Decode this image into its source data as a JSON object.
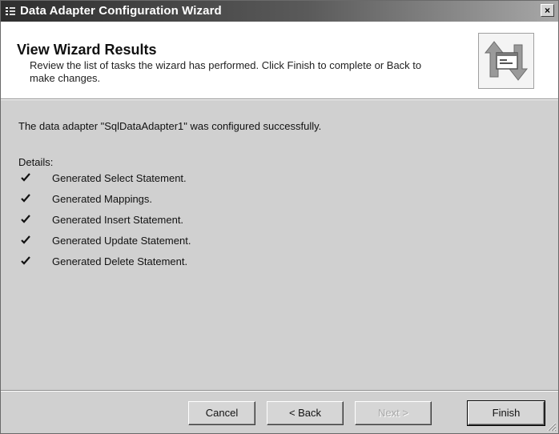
{
  "window": {
    "title": "Data Adapter Configuration Wizard",
    "close_glyph": "×"
  },
  "header": {
    "title": "View Wizard Results",
    "description": "Review the list of tasks the wizard has performed. Click Finish to complete or Back to make changes."
  },
  "main": {
    "success_message": "The data adapter \"SqlDataAdapter1\" was configured successfully.",
    "details_label": "Details:",
    "tasks": [
      {
        "label": "Generated Select Statement.",
        "status": "checked"
      },
      {
        "label": "Generated Mappings.",
        "status": "checked"
      },
      {
        "label": "Generated Insert Statement.",
        "status": "checked"
      },
      {
        "label": "Generated Update Statement.",
        "status": "checked"
      },
      {
        "label": "Generated Delete Statement.",
        "status": "checked"
      }
    ]
  },
  "buttons": {
    "cancel": "Cancel",
    "back": "< Back",
    "next": "Next >",
    "finish": "Finish"
  },
  "icons": {
    "title_icon": "wizard-app-icon",
    "header_image": "data-adapter-transfer-icon",
    "task_status": "checkmark-icon"
  },
  "colors": {
    "title_bar_start": "#2e2e2e",
    "title_bar_end": "#a8a8a8",
    "header_bg": "#ffffff",
    "body_bg": "#d0d0d0",
    "disabled_text": "#a8a8a8"
  }
}
